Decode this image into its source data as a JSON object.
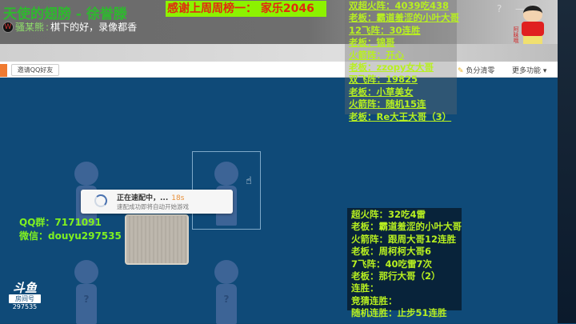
{
  "stream_title": "天使的翅膀 - 徐誉滕",
  "banner": "感谢上周周榜一：  家乐2046",
  "chat": {
    "avatar_letter": "W",
    "user": "骚某熊",
    "sep": ":",
    "message": "棋下的好，录像都香"
  },
  "toolbar": {
    "invite": "邀请QQ好友",
    "reset_score": "负分清零",
    "more": "更多功能 ▾"
  },
  "window_buttons": {
    "help": "?",
    "minimize": "—",
    "maximize": "☐"
  },
  "top_panel": [
    "双超火阵：4039吃438",
    "老板：霸道羞涩的小叶大哥",
    "12飞阵：30连胜",
    "老板：锦哥",
    "火箭阵：开心",
    "老板：zzopy女大哥",
    "双飞阵：19825",
    "老板：小草美女",
    "火箭阵：随机15连",
    "老板：Re大王大哥（3）"
  ],
  "bottom_panel": [
    "超火阵：32吃4雷",
    "老板：霸道羞涩的小叶大哥",
    "火箭阵：跟周大哥12连胜",
    "老板：周柯柯大哥6",
    "7飞阵：40吃雷7次",
    "老板：那行大哥（2）",
    "连胜：",
    "竞猜连胜：",
    "随机连胜：止步51连胜"
  ],
  "contact": {
    "qq": "QQ群：7171091",
    "wechat": "微信：douyu297535"
  },
  "matching": {
    "title": "正在速配中，...",
    "timer": "18s",
    "subtitle": "速配成功即将自动开始游戏"
  },
  "player_mark": "?",
  "douyu": {
    "logo": "斗鱼",
    "room_label": "房间号",
    "room": "297535"
  },
  "mascot_text": "阿昧哦"
}
